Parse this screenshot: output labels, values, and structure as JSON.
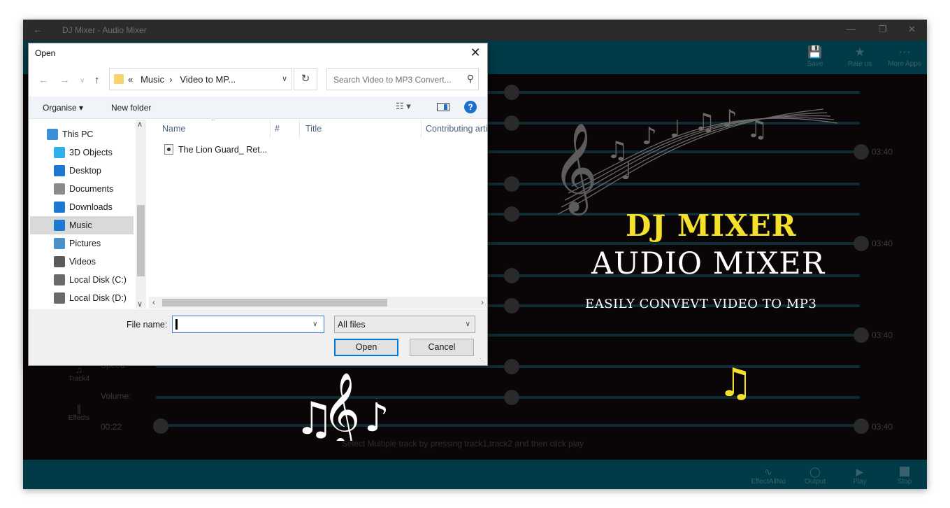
{
  "app": {
    "window_title": "DJ Mixer - Audio Mixer",
    "toolbar": {
      "save": "Save",
      "rate": "Rate us",
      "more": "More Apps"
    },
    "bottombar": {
      "effects_all": "EffectAllNo",
      "output": "Output",
      "play": "Play",
      "stop": "Stop"
    },
    "sidebar": {
      "track4": "Track4",
      "effects": "Effects"
    },
    "labels": {
      "speed": "Speed:",
      "volume": "Volume:"
    },
    "times": {
      "current": "00:22",
      "duration": "03:40"
    },
    "hint": "Select Multiple track by pressing track1,track2 and then click play"
  },
  "promo": {
    "title1": "DJ MIXER",
    "title2": "AUDIO MIXER",
    "subtitle": "EASILY CONVEVT VIDEO TO MP3"
  },
  "dialog": {
    "title": "Open",
    "address": {
      "prefix": "«",
      "crumb1": "Music",
      "crumb2": "Video to MP..."
    },
    "search_placeholder": "Search Video to MP3 Convert...",
    "organise": "Organise",
    "new_folder": "New folder",
    "nav_items": [
      {
        "label": "This PC",
        "icon": "this-pc-icon",
        "color": "#3c8fd8"
      },
      {
        "label": "3D Objects",
        "icon": "3d-objects-icon",
        "color": "#2fb0e8"
      },
      {
        "label": "Desktop",
        "icon": "desktop-icon",
        "color": "#1d78d3"
      },
      {
        "label": "Documents",
        "icon": "documents-icon",
        "color": "#8a8a8a"
      },
      {
        "label": "Downloads",
        "icon": "downloads-icon",
        "color": "#1d78d3"
      },
      {
        "label": "Music",
        "icon": "music-icon",
        "color": "#1d78d3"
      },
      {
        "label": "Pictures",
        "icon": "pictures-icon",
        "color": "#4a90c8"
      },
      {
        "label": "Videos",
        "icon": "videos-icon",
        "color": "#5b5b5b"
      },
      {
        "label": "Local Disk (C:)",
        "icon": "drive-c-icon",
        "color": "#6a6a6a"
      },
      {
        "label": "Local Disk (D:)",
        "icon": "drive-d-icon",
        "color": "#6a6a6a"
      }
    ],
    "selected_nav": "Music",
    "columns": [
      "Name",
      "#",
      "Title",
      "Contributing artists"
    ],
    "files": [
      {
        "name": "The Lion Guard_ Ret..."
      }
    ],
    "file_name_label": "File name:",
    "file_name_value": "",
    "file_type": "All files",
    "open_label": "Open",
    "cancel_label": "Cancel"
  },
  "colors": {
    "accent": "#0078d7",
    "toolbar_bg": "#003b47",
    "promo_yellow": "#f5e12c"
  }
}
